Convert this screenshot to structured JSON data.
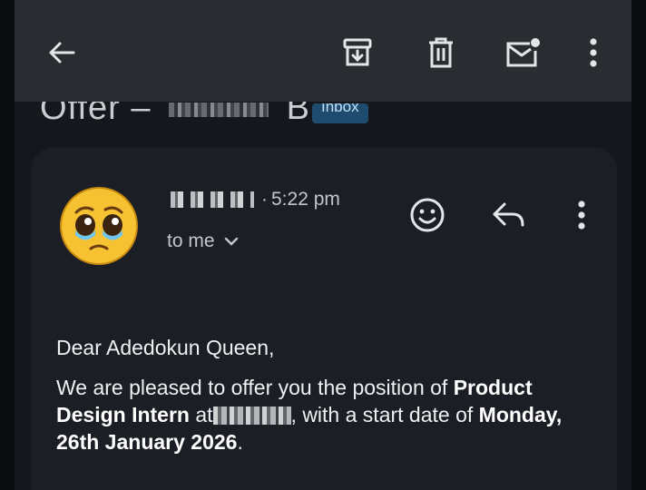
{
  "toolbar": {
    "back_icon": "arrow-left-icon",
    "archive_icon": "archive-icon",
    "delete_icon": "trash-icon",
    "mark_icon": "mark-unread-icon",
    "more_icon": "more-vert-icon"
  },
  "email": {
    "subject_prefix": "Offer –",
    "subject_suffix": "B",
    "label_badge": "Inbox",
    "time": "5:22 pm",
    "recipient": "to me",
    "avatar_emoji": "🥹"
  },
  "body": {
    "greeting": "Dear Adedokun Queen,",
    "p1_start": "We are pleased to offer you the position of ",
    "p1_role": "Product Design Intern",
    "p1_at": " at",
    "p1_mid": ", with a start date of ",
    "p1_date": "Monday, 26th January 2026",
    "p1_end": "."
  },
  "colors": {
    "toolbar_bg": "#2a2c31",
    "card_bg": "#1b1e24",
    "badge_bg": "#1e4b6e",
    "badge_text": "#bfe0f7"
  }
}
